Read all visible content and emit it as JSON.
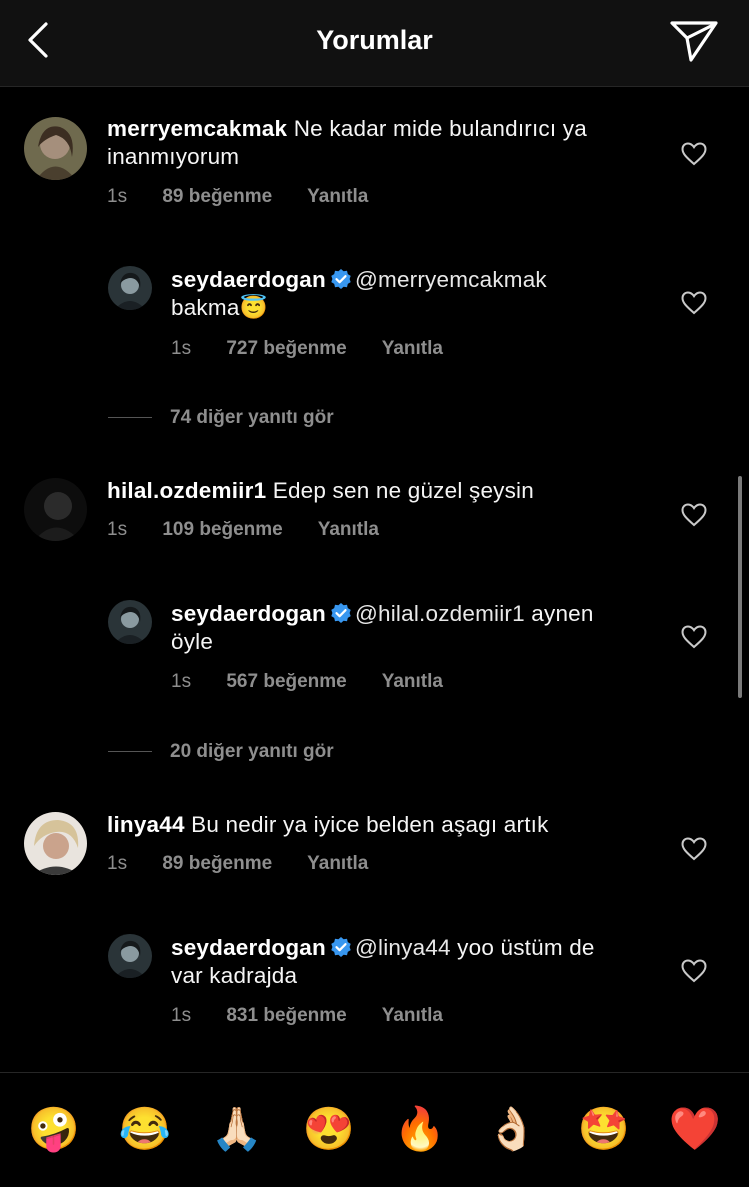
{
  "header": {
    "title": "Yorumlar"
  },
  "comments": [
    {
      "username": "merryemcakmak",
      "text_line1": "Ne kadar  mide bulandırıcı ya",
      "text_line2": "inanmıyorum",
      "time": "1s",
      "likes": "89 beğenme",
      "reply": "Yanıtla"
    },
    {
      "username": "seydaerdogan",
      "mention": "@merryemcakmak",
      "text_line2": "bakma😇",
      "time": "1s",
      "likes": "727 beğenme",
      "reply": "Yanıtla"
    },
    {
      "username": "hilal.ozdemiir1",
      "text_line1": "Edep sen ne güzel şeysin",
      "time": "1s",
      "likes": "109 beğenme",
      "reply": "Yanıtla"
    },
    {
      "username": "seydaerdogan",
      "mention": "@hilal.ozdemiir1",
      "text_line1": "aynen",
      "text_line2": "öyle",
      "time": "1s",
      "likes": "567 beğenme",
      "reply": "Yanıtla"
    },
    {
      "username": "linya44",
      "text_line1": "Bu nedir ya iyice belden aşagı artık",
      "time": "1s",
      "likes": "89 beğenme",
      "reply": "Yanıtla"
    },
    {
      "username": "seydaerdogan",
      "mention": "@linya44",
      "text_line1": "yoo üstüm de",
      "text_line2": "var kadrajda",
      "time": "1s",
      "likes": "831 beğenme",
      "reply": "Yanıtla"
    }
  ],
  "view_more": [
    "74 diğer yanıtı gör",
    "20 diğer yanıtı gör"
  ],
  "emoji_bar": [
    "🤪",
    "😂",
    "🙏🏻",
    "😍",
    "🔥",
    "👌🏻",
    "🤩",
    "❤️"
  ],
  "colors": {
    "background": "#000000",
    "secondary_text": "#8e8e8e",
    "verified_blue": "#3897f0"
  }
}
